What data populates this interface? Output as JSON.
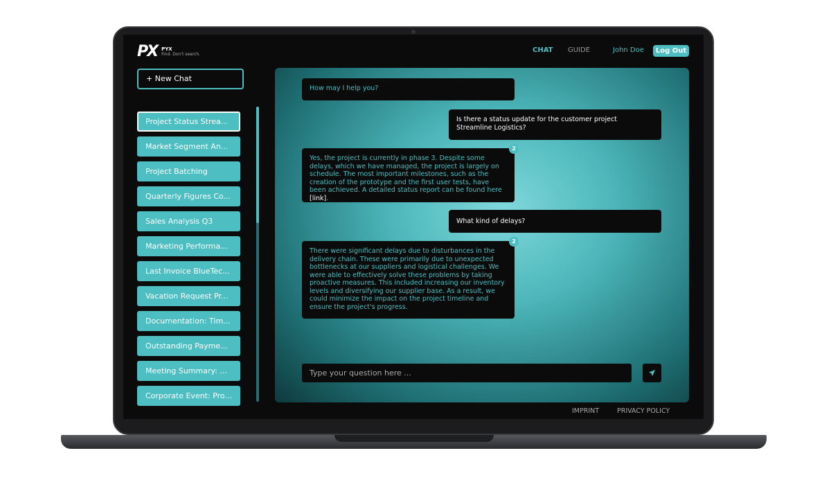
{
  "brand": {
    "mark": "PX",
    "name": "PYX",
    "tagline": "Find. Don't search."
  },
  "nav": {
    "chat": "CHAT",
    "guide": "GUIDE",
    "user": "John Doe",
    "logout": "Log Out"
  },
  "sidebar": {
    "new_chat": "+ New Chat",
    "items": [
      "Project Status Strea...",
      "Market Segment An...",
      "Project Batching",
      "Quarterly Figures Co...",
      "Sales Analysis Q3",
      "Marketing Performa...",
      "Last Invoice BlueTec...",
      "Vacation Request Pr...",
      "Documentation: Tim...",
      "Outstanding Payme...",
      "Meeting Summary: ...",
      "Corporate Event: Pro..."
    ]
  },
  "chat": {
    "messages": [
      {
        "role": "bot",
        "text": "How may I help you?"
      },
      {
        "role": "user",
        "text": "Is there a status update for the customer project Streamline Logistics?"
      },
      {
        "role": "bot",
        "text": "Yes, the project is currently in phase 3. Despite some delays, which we have managed, the project is largely on schedule. The most important milestones, such as the creation of the prototype and the first user tests, have been achieved. A detailed status report can be found here",
        "link": "[link]",
        "tail": ".",
        "badge": "2"
      },
      {
        "role": "user",
        "text": "What kind of delays?"
      },
      {
        "role": "bot",
        "text": "There were significant delays due to disturbances in the delivery chain. These were primarily due to unexpected bottlenecks at our suppliers and logistical challenges. We were able to effectively solve these problems by taking proactive measures. This included increasing our inventory levels and diversifying our supplier base. As a result, we could minimize the impact on the project timeline and ensure the project's progress.",
        "badge": "2"
      }
    ],
    "placeholder": "Type your question here ..."
  },
  "footer": {
    "imprint": "IMPRINT",
    "privacy": "PRIVACY POLICY"
  },
  "colors": {
    "accent": "#4dbfc3",
    "background": "#0b0b0b"
  }
}
